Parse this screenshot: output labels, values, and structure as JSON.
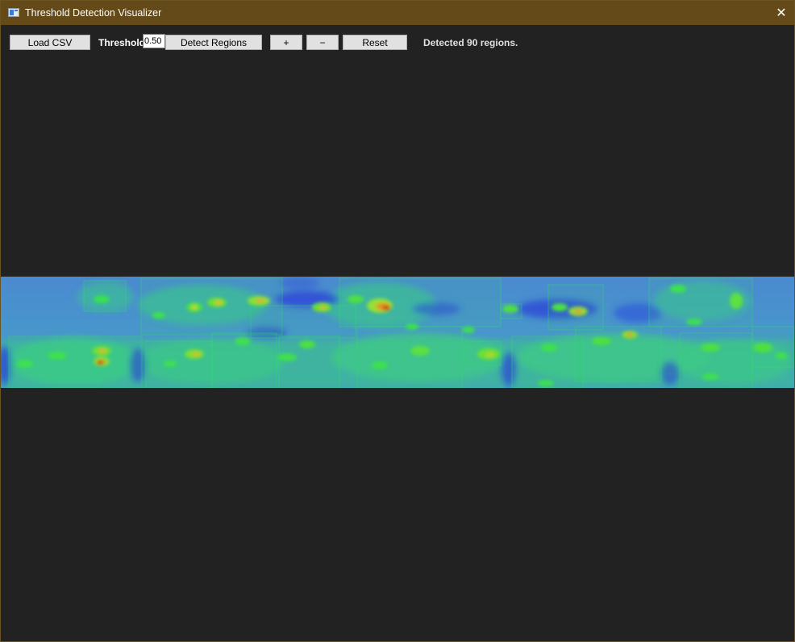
{
  "window": {
    "title": "Threshold Detection Visualizer"
  },
  "toolbar": {
    "load_label": "Load CSV",
    "threshold_label": "Threshold:",
    "threshold_value": "0.50",
    "detect_label": "Detect Regions",
    "zoom_in_label": "+",
    "zoom_out_label": "−",
    "reset_label": "Reset"
  },
  "status": {
    "text": "Detected 90 regions."
  },
  "icons": {
    "app": "app-window-icon",
    "close": "close-icon"
  },
  "heatmap": {
    "colormap": [
      "#2336d6",
      "#3a74d8",
      "#4e9fcf",
      "#3ec98a",
      "#35e05a",
      "#c8e03a",
      "#f0a020",
      "#d82a10"
    ],
    "region_outline_color": "#2ee05a",
    "detected_region_count": 90,
    "threshold": 0.5
  }
}
